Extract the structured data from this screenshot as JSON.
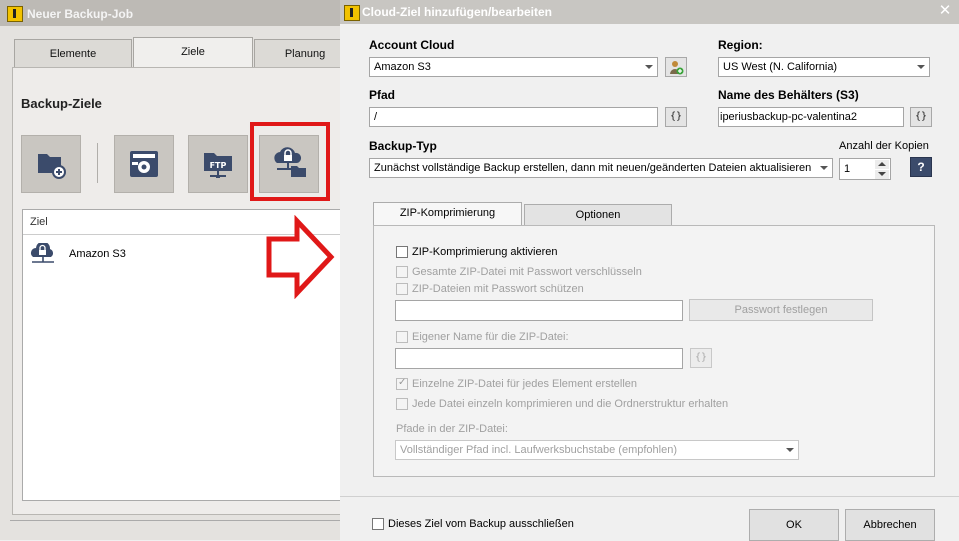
{
  "background_window": {
    "title": "Neuer Backup-Job",
    "tabs": [
      {
        "label": "Elemente",
        "active": false
      },
      {
        "label": "Ziele",
        "active": true
      },
      {
        "label": "Planung",
        "active": false
      }
    ],
    "section_title": "Backup-Ziele",
    "destination_buttons": [
      {
        "icon": "folder-add-icon"
      },
      {
        "icon": "tape-drive-icon"
      },
      {
        "icon": "ftp-folder-icon",
        "text": "FTP"
      },
      {
        "icon": "cloud-folder-icon",
        "highlighted": true
      }
    ],
    "list": {
      "column_header": "Ziel",
      "items": [
        {
          "label": "Amazon S3",
          "icon": "cloud-lock-icon"
        }
      ]
    }
  },
  "dialog": {
    "title": "Cloud-Ziel hinzufügen/bearbeiten",
    "account_label": "Account Cloud",
    "account_value": "Amazon S3",
    "region_label": "Region:",
    "region_value": "US West (N. California)",
    "path_label": "Pfad",
    "path_value": "/",
    "bucket_label": "Name des Behälters (S3)",
    "bucket_value": "iperiusbackup-pc-valentina2",
    "backup_type_label": "Backup-Typ",
    "backup_type_value": "Zunächst vollständige Backup erstellen, dann mit neuen/geänderten Dateien aktualisieren",
    "copies_label": "Anzahl der Kopien",
    "copies_value": "1",
    "help_label": "?",
    "var_button_label": "{}",
    "tabs": [
      {
        "label": "ZIP-Komprimierung",
        "active": true
      },
      {
        "label": "Optionen",
        "active": false
      }
    ],
    "zip": {
      "enable_label": "ZIP-Komprimierung aktivieren",
      "encrypt_label": "Gesamte ZIP-Datei mit Passwort verschlüsseln",
      "protect_label": "ZIP-Dateien mit Passwort schützen",
      "password_button": "Passwort festlegen",
      "custom_name_label": "Eigener Name für die ZIP-Datei:",
      "single_zip_label": "Einzelne ZIP-Datei für jedes Element erstellen",
      "each_file_label": "Jede Datei einzeln komprimieren und die Ordnerstruktur erhalten",
      "paths_label": "Pfade in der ZIP-Datei:",
      "paths_value": "Vollständiger Pfad incl. Laufwerksbuchstabe (empfohlen)"
    },
    "exclude_label": "Dieses Ziel vom Backup ausschließen",
    "ok_label": "OK",
    "cancel_label": "Abbrechen"
  },
  "colors": {
    "highlight_red": "#e01818",
    "icon_blue": "#3b4b6b",
    "app_icon_yellow": "#f2c200"
  }
}
